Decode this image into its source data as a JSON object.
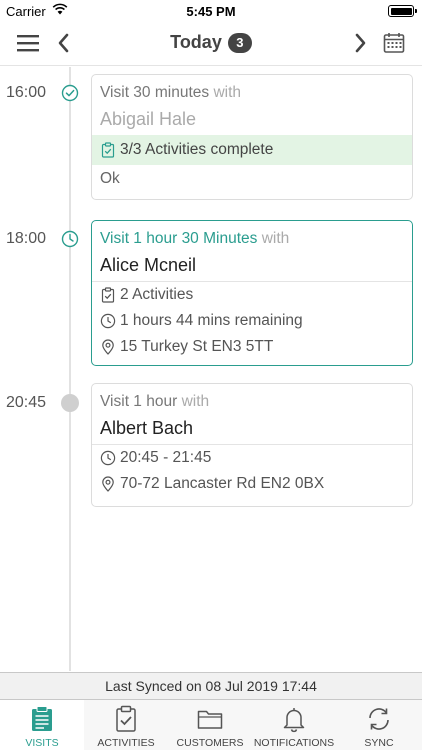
{
  "status_bar": {
    "carrier": "Carrier",
    "time": "5:45 PM"
  },
  "header": {
    "title": "Today",
    "count": "3"
  },
  "visits": [
    {
      "time": "16:00",
      "status_icon": "check-circle-icon",
      "duration": "Visit 30 minutes",
      "with": "with",
      "customer": "Abigail Hale",
      "activities": "3/3 Activities complete",
      "note": "Ok"
    },
    {
      "time": "18:00",
      "status_icon": "clock-icon",
      "duration": "Visit 1 hour 30 Minutes",
      "with": "with",
      "customer": "Alice Mcneil",
      "activities": "2 Activities",
      "remaining": "1 hours 44 mins remaining",
      "address": "15 Turkey St  EN3 5TT"
    },
    {
      "time": "20:45",
      "status_icon": "grey-dot",
      "duration": "Visit 1 hour",
      "with": "with",
      "customer": "Albert Bach",
      "time_range": "20:45 - 21:45",
      "address": "70-72 Lancaster Rd  EN2 0BX"
    }
  ],
  "sync": {
    "text": "Last Synced on 08 Jul 2019 17:44"
  },
  "tabs": [
    {
      "label": "VISITS",
      "icon": "clipboard-list-icon",
      "active": true
    },
    {
      "label": "ACTIVITIES",
      "icon": "clipboard-check-icon",
      "active": false
    },
    {
      "label": "CUSTOMERS",
      "icon": "folder-icon",
      "active": false
    },
    {
      "label": "NOTIFICATIONS",
      "icon": "bell-icon",
      "active": false
    },
    {
      "label": "SYNC",
      "icon": "sync-icon",
      "active": false
    }
  ],
  "colors": {
    "accent": "#2a9d8f",
    "complete_bg": "#e3f4e4",
    "timeline": "#e2e2e2"
  }
}
